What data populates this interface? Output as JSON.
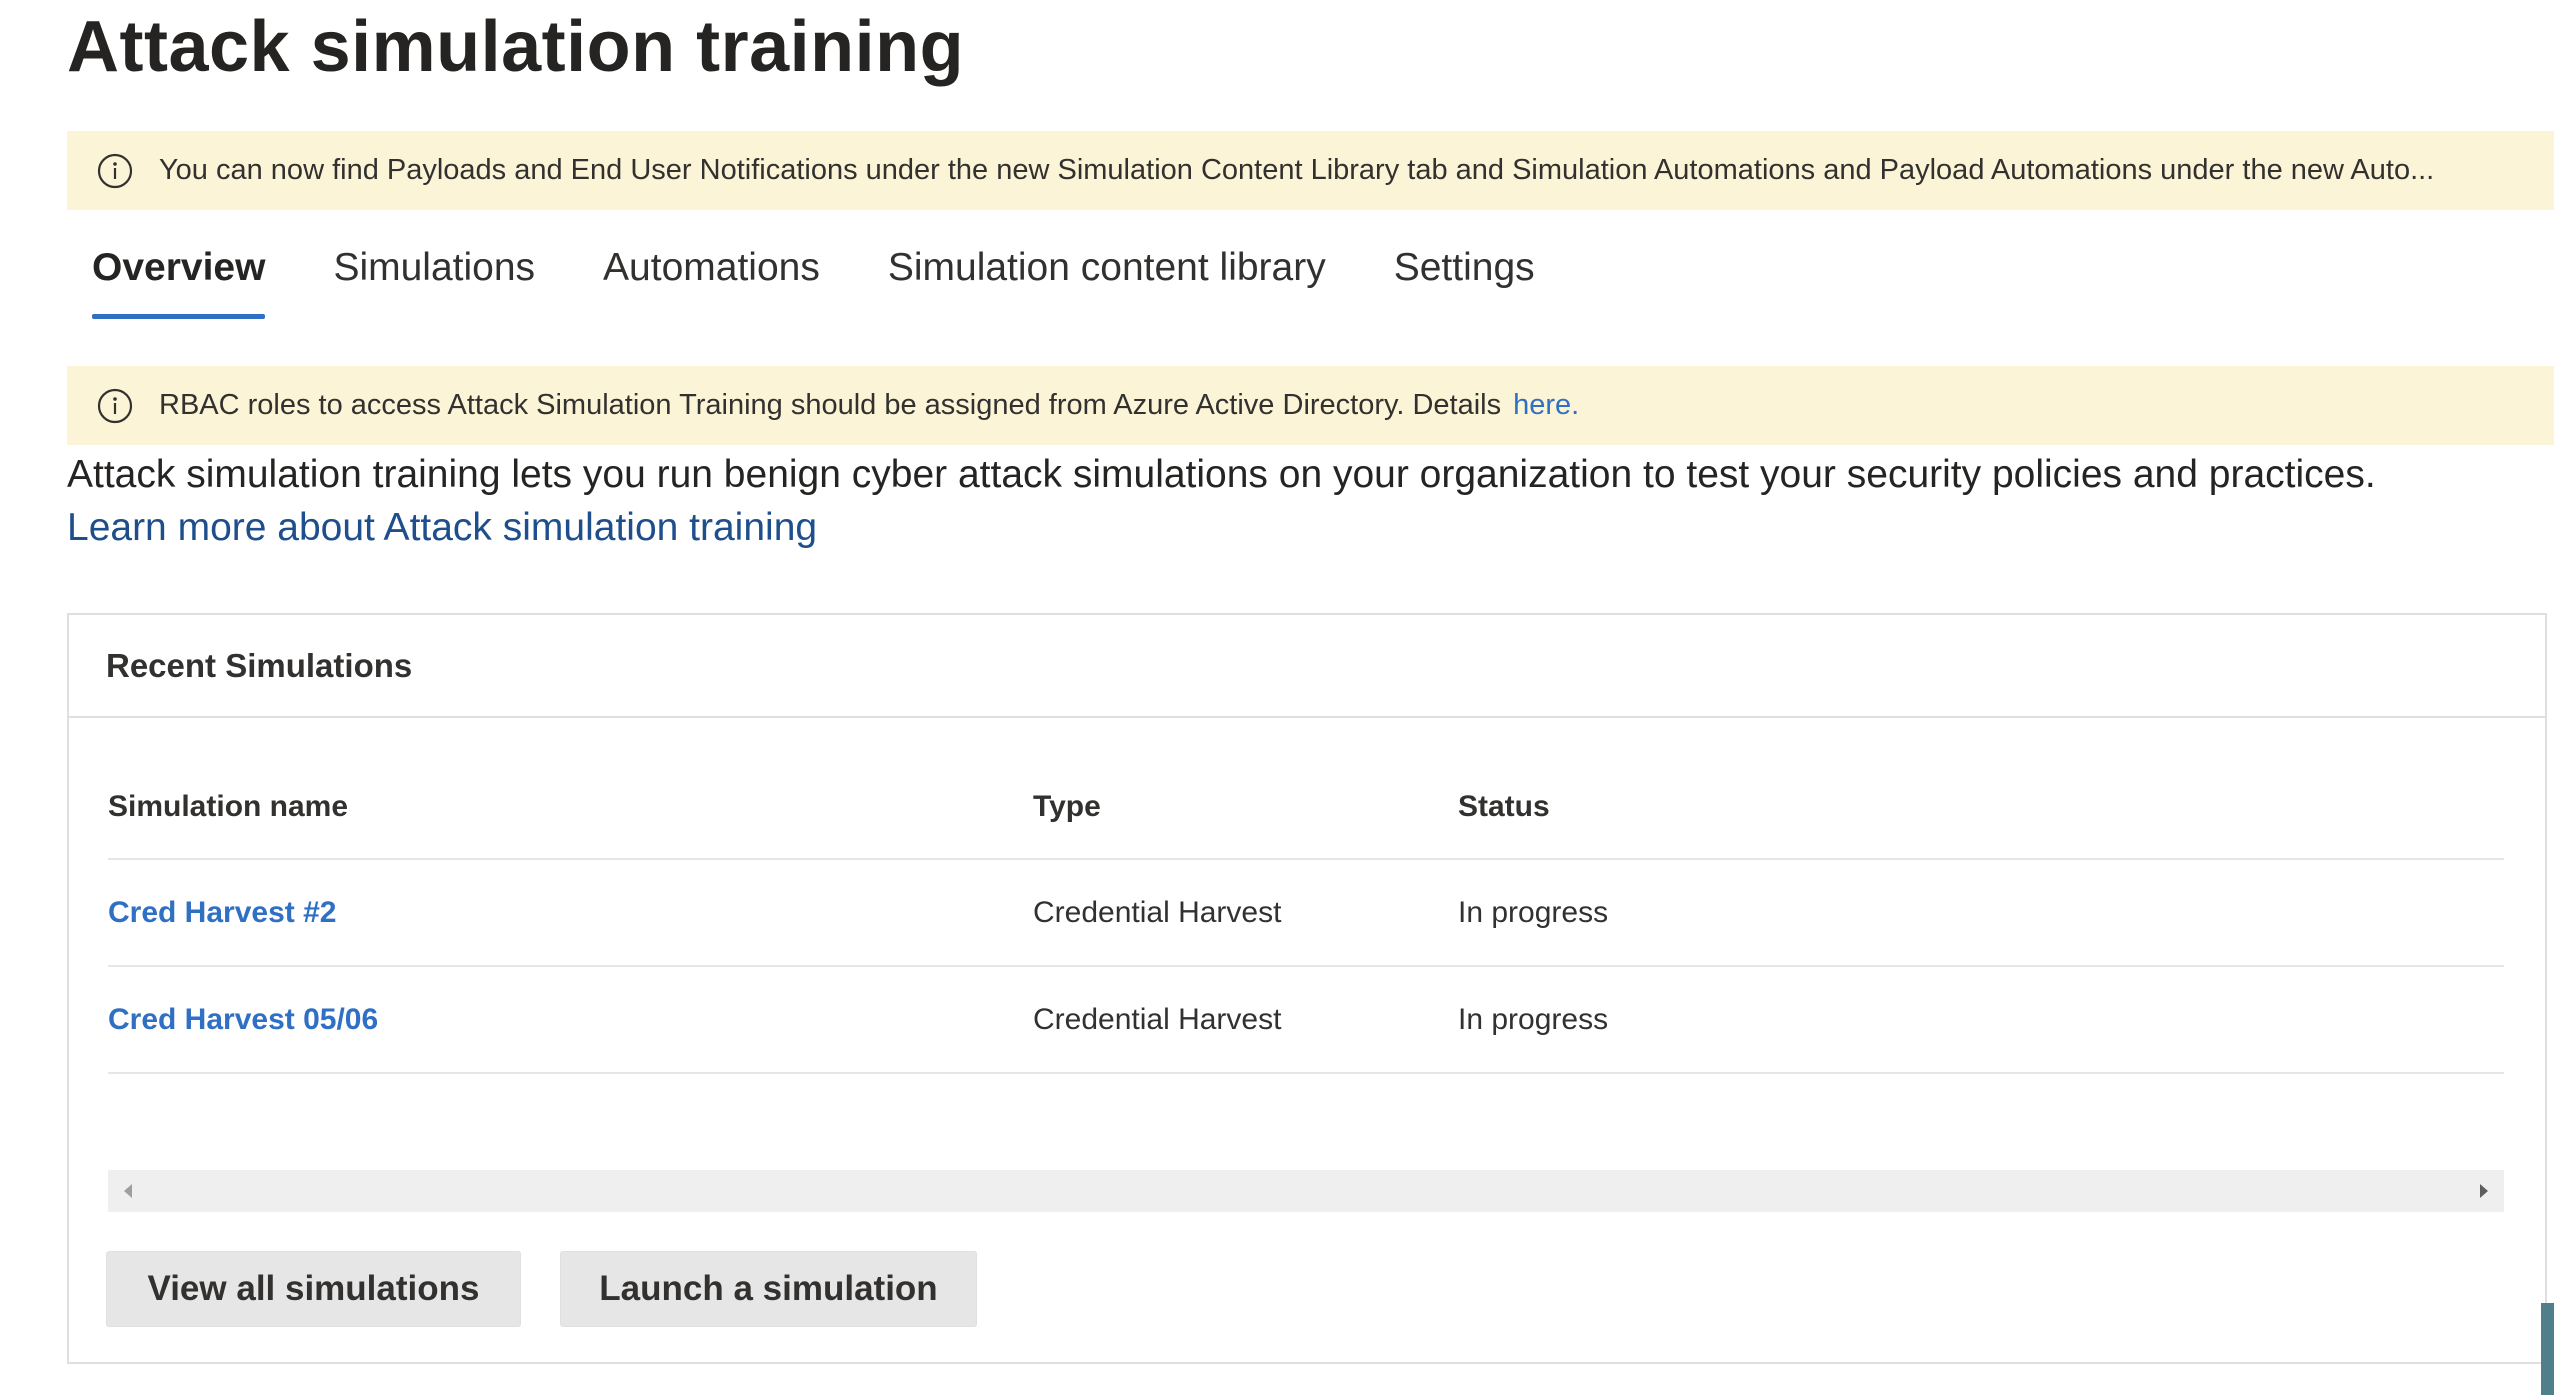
{
  "page": {
    "title": "Attack simulation training"
  },
  "banners": {
    "content_library": {
      "icon": "info-icon",
      "text": "You can now find Payloads and End User Notifications under the new Simulation Content Library tab and Simulation Automations and Payload Automations under the new Auto..."
    },
    "rbac": {
      "icon": "info-icon",
      "text": "RBAC roles to access Attack Simulation Training should be assigned from Azure Active Directory. Details",
      "link": "here."
    }
  },
  "tabs": [
    {
      "label": "Overview",
      "active": true
    },
    {
      "label": "Simulations",
      "active": false
    },
    {
      "label": "Automations",
      "active": false
    },
    {
      "label": "Simulation content library",
      "active": false
    },
    {
      "label": "Settings",
      "active": false
    }
  ],
  "intro": {
    "description": "Attack simulation training lets you run benign cyber attack simulations on your organization to test your security policies and practices.",
    "learn_more": "Learn more about Attack simulation training"
  },
  "recent_simulations": {
    "title": "Recent Simulations",
    "columns": {
      "name": "Simulation name",
      "type": "Type",
      "status": "Status"
    },
    "rows": [
      {
        "name": "Cred Harvest #2",
        "type": "Credential Harvest",
        "status": "In progress"
      },
      {
        "name": "Cred Harvest 05/06",
        "type": "Credential Harvest",
        "status": "In progress"
      }
    ],
    "buttons": {
      "view_all": "View all simulations",
      "launch": "Launch a simulation"
    }
  },
  "colors": {
    "banner_bg": "#fcf4d6",
    "accent": "#2f6fc4",
    "link": "#1e4e8c"
  }
}
